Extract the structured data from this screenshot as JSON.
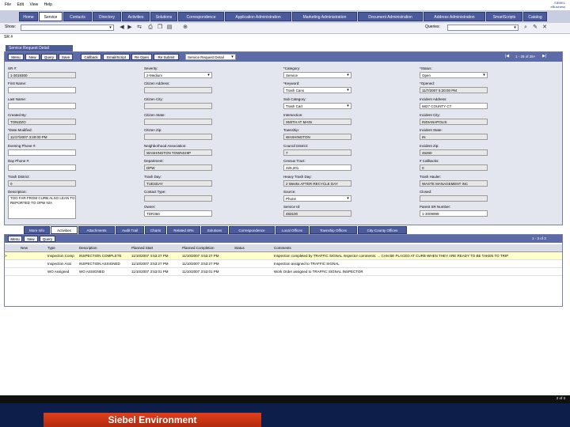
{
  "menu": [
    "File",
    "Edit",
    "View",
    "Help"
  ],
  "brand": {
    "line1": "SIEBEL",
    "line2": "eBusiness"
  },
  "tabs": [
    "Home",
    "Service",
    "Contacts",
    "Directory",
    "Activities",
    "Solutions",
    "Correspondence",
    "Application Administration",
    "Marketing Administration",
    "Document Administration",
    "Address Administration",
    "SmartScripts",
    "Catalog"
  ],
  "active_tab": "Service",
  "toolbar": {
    "show_label": "Show:",
    "queries_label": "Queries:"
  },
  "breadcrumb": "SR #",
  "applet_title": "Service Request Detail",
  "applet_buttons": [
    "Menu",
    "New",
    "Query",
    "Save",
    "Callback",
    "Email/Script",
    "Re Open",
    "Re Submit"
  ],
  "view_select": "Service Request Detail",
  "record_count": "1 - 28 of 28+",
  "fields": {
    "sr_num": {
      "label": "SR #:",
      "value": "1-3019300"
    },
    "first_name": {
      "label": "First Name:",
      "value": ""
    },
    "last_name": {
      "label": "Last Name:",
      "value": ""
    },
    "created_by": {
      "label": "Created By:",
      "value": "TONIZZO"
    },
    "date_modified": {
      "label": "*Date Modified:",
      "value": "11/17/2007 3:20:00 PM"
    },
    "evening_phone": {
      "label": "Evening Phone #:",
      "value": ""
    },
    "day_phone": {
      "label": "Day Phone #:",
      "value": ""
    },
    "trash_district": {
      "label": "Trash District:",
      "value": "0"
    },
    "description": {
      "label": "Description:",
      "value": "TOO FAR FROM CURB ALSO LEAN TO REPORTED TO OPW N/A"
    },
    "severity": {
      "label": "Severity:",
      "value": "2-Medium"
    },
    "citizen_address": {
      "label": "Citizen Address:",
      "value": ""
    },
    "citizen_city": {
      "label": "Citizen City:",
      "value": ""
    },
    "citizen_state": {
      "label": "Citizen State:",
      "value": ""
    },
    "citizen_zip": {
      "label": "Citizen Zip:",
      "value": ""
    },
    "neighborhood": {
      "label": "Neighborhood Association:",
      "value": "WASHINGTON TOWNSHIP"
    },
    "department": {
      "label": "Department:",
      "value": "DPW"
    },
    "trash_day": {
      "label": "Trash Day:",
      "value": "TUESDAY"
    },
    "contact_type": {
      "label": "Contact Type:",
      "value": ""
    },
    "owner": {
      "label": "Owner:",
      "value": "TDR360"
    },
    "category": {
      "label": "*Category:",
      "value": "Service"
    },
    "keyword": {
      "label": "*Keyword:",
      "value": "Trash Cans"
    },
    "sub_category": {
      "label": "Sub Category:",
      "value": "Trash Cart"
    },
    "intersection": {
      "label": "Intersection:",
      "value": "SMITH AT MAIN"
    },
    "township": {
      "label": "Township:",
      "value": "WASHINGTON"
    },
    "council_district": {
      "label": "Council District:",
      "value": "7"
    },
    "census_tract": {
      "label": "Census Tract:",
      "value": "329,201"
    },
    "heavy_trash": {
      "label": "Heavy Trash Day:",
      "value": "2 Weeks AFTER RECYCLE DAY"
    },
    "source": {
      "label": "Source:",
      "value": "Phone"
    },
    "service_id": {
      "label": "Service Id:",
      "value": "483100"
    },
    "status": {
      "label": "*Status:",
      "value": "Open"
    },
    "opened": {
      "label": "*Opened:",
      "value": "11/7/2007 5:20:00 PM"
    },
    "incident_address": {
      "label": "Incident Address:",
      "value": "6827 COUNTY CT"
    },
    "incident_city": {
      "label": "Incident City:",
      "value": "INDIANAPOLIS"
    },
    "incident_state": {
      "label": "Incident State:",
      "value": "IN"
    },
    "incident_zip": {
      "label": "Incident Zip:",
      "value": "46260"
    },
    "callbacks": {
      "label": "# Callbacks:",
      "value": "0"
    },
    "trash_hauler": {
      "label": "Trash Hauler:",
      "value": "WASTE MANAGEMENT INC"
    },
    "closed": {
      "label": "Closed:",
      "value": ""
    },
    "parent_sr": {
      "label": "Parent SR Number:",
      "value": "1-3009999"
    }
  },
  "list_tabs": [
    "More Info",
    "Activities",
    "Attachments",
    "Audit Trail",
    "Charts",
    "Related SRs",
    "Solutions",
    "Correspondence",
    "Local Offices",
    "Township Offices",
    "City-County Offices"
  ],
  "active_list_tab": "Activities",
  "list_buttons": [
    "Menu",
    "New",
    "Query"
  ],
  "list_count": "1 - 3 of 3",
  "list_columns": [
    "New",
    "Type",
    "Description",
    "Planned Start",
    "Planned Completion",
    "Status",
    "Comments"
  ],
  "list_rows": [
    {
      "new": "",
      "type": "Inspection Comp",
      "description": "INSPECTION COMPLETE",
      "start": "11/10/2007 4:53:27 PM",
      "end": "11/10/2007 4:53:27 PM",
      "status": "",
      "comments": "Inspection completed by TRAFFIC SIGNAL Inspector comments: ... CAN BE PLACED AT CURB WHEN THEY ARE READY TO BE TAKEN TO TRIP"
    },
    {
      "new": "",
      "type": "Inspection Assi",
      "description": "INSPECTION ASSIGNED",
      "start": "11/10/2007 3:53:27 PM",
      "end": "11/10/2007 3:53:27 PM",
      "status": "",
      "comments": "Inspection assigned to TRAFFIC SIGNAL"
    },
    {
      "new": "",
      "type": "WO Assigned",
      "description": "WO ASSIGNED",
      "start": "11/10/2007 3:53:01 PM",
      "end": "11/10/2007 3:53:01 PM",
      "status": "",
      "comments": "Work Order assigned to TRAFFIC SIGNAL INSPECTOR"
    }
  ],
  "page_number": "2 of 3",
  "footer": "Siebel Environment",
  "colors": {
    "tab_bg": "#4a5a9a",
    "applet_bar": "#5c6aa8",
    "highlight_row": "#ffffcc",
    "footer_bg": "#0d1e4a",
    "footer_box": "#d0381a"
  }
}
